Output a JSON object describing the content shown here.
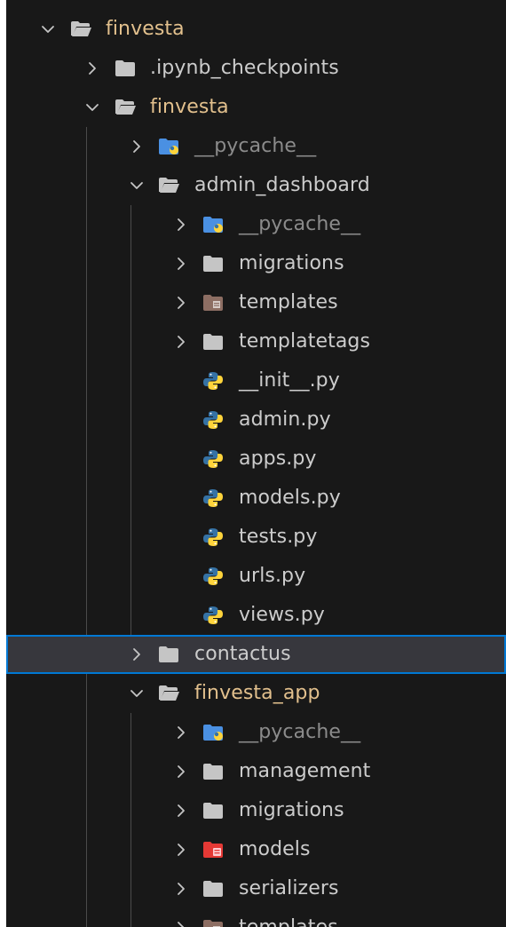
{
  "explorer": {
    "colors": {
      "background": "#181818",
      "text": "#cccccc",
      "dimmed_text": "#8b8b8b",
      "modified_text": "#e2c08d",
      "selection_border": "#0078d4",
      "selection_bg": "#37373d",
      "folder_icon": "#c5c5c5",
      "python_blue": "#3572A5",
      "python_yellow": "#FFD43B"
    },
    "items": [
      {
        "label": "finvesta",
        "icon": "folder-open-icon",
        "chevron": "chevron-down",
        "tone": "orange"
      },
      {
        "label": ".ipynb_checkpoints",
        "icon": "folder-icon",
        "chevron": "chevron-right",
        "tone": "normal"
      },
      {
        "label": "finvesta",
        "icon": "folder-open-icon",
        "chevron": "chevron-down",
        "tone": "orange"
      },
      {
        "label": "__pycache__",
        "icon": "python-folder-icon",
        "chevron": "chevron-right",
        "tone": "dim"
      },
      {
        "label": "admin_dashboard",
        "icon": "folder-open-icon",
        "chevron": "chevron-down",
        "tone": "normal"
      },
      {
        "label": "__pycache__",
        "icon": "python-folder-icon",
        "chevron": "chevron-right",
        "tone": "dim"
      },
      {
        "label": "migrations",
        "icon": "folder-icon",
        "chevron": "chevron-right",
        "tone": "normal"
      },
      {
        "label": "templates",
        "icon": "templates-folder-icon",
        "chevron": "chevron-right",
        "tone": "normal"
      },
      {
        "label": "templatetags",
        "icon": "folder-icon",
        "chevron": "chevron-right",
        "tone": "normal"
      },
      {
        "label": "__init__.py",
        "icon": "python-file-icon",
        "chevron": "",
        "tone": "normal"
      },
      {
        "label": "admin.py",
        "icon": "python-file-icon",
        "chevron": "",
        "tone": "normal"
      },
      {
        "label": "apps.py",
        "icon": "python-file-icon",
        "chevron": "",
        "tone": "normal"
      },
      {
        "label": "models.py",
        "icon": "python-file-icon",
        "chevron": "",
        "tone": "normal"
      },
      {
        "label": "tests.py",
        "icon": "python-file-icon",
        "chevron": "",
        "tone": "normal"
      },
      {
        "label": "urls.py",
        "icon": "python-file-icon",
        "chevron": "",
        "tone": "normal"
      },
      {
        "label": "views.py",
        "icon": "python-file-icon",
        "chevron": "",
        "tone": "normal"
      },
      {
        "label": "contactus",
        "icon": "folder-icon",
        "chevron": "chevron-right",
        "tone": "normal",
        "selected": true
      },
      {
        "label": "finvesta_app",
        "icon": "folder-open-icon",
        "chevron": "chevron-down",
        "tone": "orange"
      },
      {
        "label": "__pycache__",
        "icon": "python-folder-icon",
        "chevron": "chevron-right",
        "tone": "dim"
      },
      {
        "label": "management",
        "icon": "folder-icon",
        "chevron": "chevron-right",
        "tone": "normal"
      },
      {
        "label": "migrations",
        "icon": "folder-icon",
        "chevron": "chevron-right",
        "tone": "normal"
      },
      {
        "label": "models",
        "icon": "models-folder-icon",
        "chevron": "chevron-right",
        "tone": "normal"
      },
      {
        "label": "serializers",
        "icon": "folder-icon",
        "chevron": "chevron-right",
        "tone": "normal"
      },
      {
        "label": "templates",
        "icon": "templates-folder-icon",
        "chevron": "chevron-right",
        "tone": "normal"
      }
    ]
  }
}
